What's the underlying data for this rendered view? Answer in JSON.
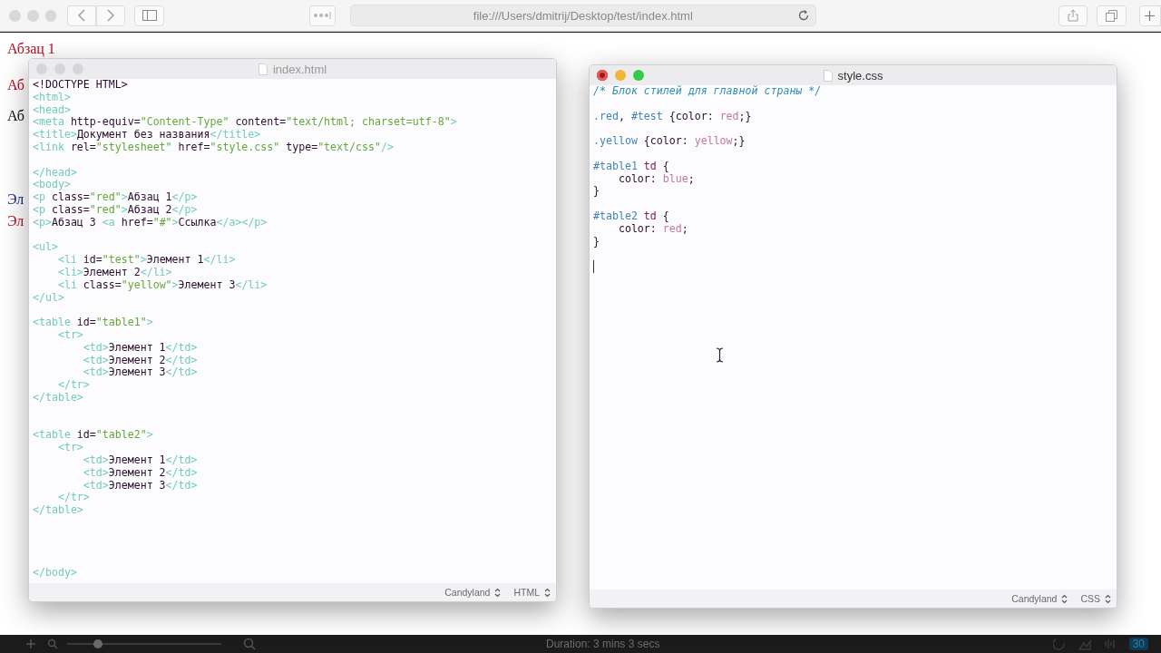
{
  "browser": {
    "url": "file:///Users/dmitrij/Desktop/test/index.html"
  },
  "page_text": [
    {
      "text": "Абзац 1",
      "color": "#b3122e",
      "kind": "paragraph"
    },
    {
      "text": "Аб",
      "color": "#b3122e",
      "kind": "paragraph"
    },
    {
      "text": "Аб",
      "color": "#111111",
      "kind": "paragraph"
    },
    {
      "text": "Эл",
      "color": "#1c2a8c",
      "kind": "cell"
    },
    {
      "text": "Эл",
      "color": "#b3122e",
      "kind": "cell"
    }
  ],
  "editors": [
    {
      "title": "index.html",
      "active": false,
      "footer": [
        "Candyland",
        "HTML"
      ],
      "lines": [
        {
          "kind": "code",
          "tokens": [
            {
              "t": "<!DOCTYPE HTML>",
              "kind": "text"
            }
          ]
        },
        {
          "kind": "code",
          "tokens": [
            {
              "t": "<html>",
              "kind": "tag"
            }
          ]
        },
        {
          "kind": "code",
          "tokens": [
            {
              "t": "<head>",
              "kind": "tag"
            }
          ]
        },
        {
          "kind": "code",
          "tokens": [
            {
              "t": "<meta",
              "kind": "tag"
            },
            {
              "t": " http-equiv=",
              "kind": "attr"
            },
            {
              "t": "\"Content-Type\"",
              "kind": "str"
            },
            {
              "t": " content=",
              "kind": "attr"
            },
            {
              "t": "\"text/html; charset=utf-8\"",
              "kind": "str"
            },
            {
              "t": ">",
              "kind": "tag"
            }
          ]
        },
        {
          "kind": "code",
          "tokens": [
            {
              "t": "<title>",
              "kind": "tag"
            },
            {
              "t": "Документ без названия",
              "kind": "text"
            },
            {
              "t": "</title>",
              "kind": "tag"
            }
          ]
        },
        {
          "kind": "code",
          "tokens": [
            {
              "t": "<link",
              "kind": "tag"
            },
            {
              "t": " rel=",
              "kind": "attr"
            },
            {
              "t": "\"stylesheet\"",
              "kind": "str"
            },
            {
              "t": " href=",
              "kind": "attr"
            },
            {
              "t": "\"style.css\"",
              "kind": "str"
            },
            {
              "t": " type=",
              "kind": "attr"
            },
            {
              "t": "\"text/css\"",
              "kind": "str"
            },
            {
              "t": "/>",
              "kind": "tag"
            }
          ]
        },
        {
          "kind": "blank"
        },
        {
          "kind": "code",
          "tokens": [
            {
              "t": "</head>",
              "kind": "tag"
            }
          ]
        },
        {
          "kind": "code",
          "tokens": [
            {
              "t": "<body>",
              "kind": "tag"
            }
          ]
        },
        {
          "kind": "code",
          "tokens": [
            {
              "t": "<p",
              "kind": "tag"
            },
            {
              "t": " class=",
              "kind": "attr"
            },
            {
              "t": "\"red\"",
              "kind": "str"
            },
            {
              "t": ">",
              "kind": "tag"
            },
            {
              "t": "Абзац 1",
              "kind": "text"
            },
            {
              "t": "</p>",
              "kind": "tag"
            }
          ]
        },
        {
          "kind": "code",
          "tokens": [
            {
              "t": "<p",
              "kind": "tag"
            },
            {
              "t": " class=",
              "kind": "attr"
            },
            {
              "t": "\"red\"",
              "kind": "str"
            },
            {
              "t": ">",
              "kind": "tag"
            },
            {
              "t": "Абзац 2",
              "kind": "text"
            },
            {
              "t": "</p>",
              "kind": "tag"
            }
          ]
        },
        {
          "kind": "code",
          "tokens": [
            {
              "t": "<p>",
              "kind": "tag"
            },
            {
              "t": "Абзац 3 ",
              "kind": "text"
            },
            {
              "t": "<a",
              "kind": "tag"
            },
            {
              "t": " href=",
              "kind": "attr"
            },
            {
              "t": "\"#\"",
              "kind": "str"
            },
            {
              "t": ">",
              "kind": "tag"
            },
            {
              "t": "Ссылка",
              "kind": "text"
            },
            {
              "t": "</a></p>",
              "kind": "tag"
            }
          ]
        },
        {
          "kind": "blank"
        },
        {
          "kind": "code",
          "tokens": [
            {
              "t": "<ul>",
              "kind": "tag"
            }
          ]
        },
        {
          "kind": "code",
          "tokens": [
            {
              "t": "    <li",
              "kind": "tag"
            },
            {
              "t": " id=",
              "kind": "attr"
            },
            {
              "t": "\"test\"",
              "kind": "str"
            },
            {
              "t": ">",
              "kind": "tag"
            },
            {
              "t": "Элемент 1",
              "kind": "text"
            },
            {
              "t": "</li>",
              "kind": "tag"
            }
          ]
        },
        {
          "kind": "code",
          "tokens": [
            {
              "t": "    <li>",
              "kind": "tag"
            },
            {
              "t": "Элемент 2",
              "kind": "text"
            },
            {
              "t": "</li>",
              "kind": "tag"
            }
          ]
        },
        {
          "kind": "code",
          "tokens": [
            {
              "t": "    <li",
              "kind": "tag"
            },
            {
              "t": " class=",
              "kind": "attr"
            },
            {
              "t": "\"yellow\"",
              "kind": "str"
            },
            {
              "t": ">",
              "kind": "tag"
            },
            {
              "t": "Элемент 3",
              "kind": "text"
            },
            {
              "t": "</li>",
              "kind": "tag"
            }
          ]
        },
        {
          "kind": "code",
          "tokens": [
            {
              "t": "</ul>",
              "kind": "tag"
            }
          ]
        },
        {
          "kind": "blank"
        },
        {
          "kind": "code",
          "tokens": [
            {
              "t": "<table",
              "kind": "tag"
            },
            {
              "t": " id=",
              "kind": "attr"
            },
            {
              "t": "\"table1\"",
              "kind": "str"
            },
            {
              "t": ">",
              "kind": "tag"
            }
          ]
        },
        {
          "kind": "code",
          "tokens": [
            {
              "t": "    <tr>",
              "kind": "tag"
            }
          ]
        },
        {
          "kind": "code",
          "tokens": [
            {
              "t": "        <td>",
              "kind": "tag"
            },
            {
              "t": "Элемент 1",
              "kind": "text"
            },
            {
              "t": "</td>",
              "kind": "tag"
            }
          ]
        },
        {
          "kind": "code",
          "tokens": [
            {
              "t": "        <td>",
              "kind": "tag"
            },
            {
              "t": "Элемент 2",
              "kind": "text"
            },
            {
              "t": "</td>",
              "kind": "tag"
            }
          ]
        },
        {
          "kind": "code",
          "tokens": [
            {
              "t": "        <td>",
              "kind": "tag"
            },
            {
              "t": "Элемент 3",
              "kind": "text"
            },
            {
              "t": "</td>",
              "kind": "tag"
            }
          ]
        },
        {
          "kind": "code",
          "tokens": [
            {
              "t": "    </tr>",
              "kind": "tag"
            }
          ]
        },
        {
          "kind": "code",
          "tokens": [
            {
              "t": "</table>",
              "kind": "tag"
            }
          ]
        },
        {
          "kind": "blank"
        },
        {
          "kind": "blank"
        },
        {
          "kind": "code",
          "tokens": [
            {
              "t": "<table",
              "kind": "tag"
            },
            {
              "t": " id=",
              "kind": "attr"
            },
            {
              "t": "\"table2\"",
              "kind": "str"
            },
            {
              "t": ">",
              "kind": "tag"
            }
          ]
        },
        {
          "kind": "code",
          "tokens": [
            {
              "t": "    <tr>",
              "kind": "tag"
            }
          ]
        },
        {
          "kind": "code",
          "tokens": [
            {
              "t": "        <td>",
              "kind": "tag"
            },
            {
              "t": "Элемент 1",
              "kind": "text"
            },
            {
              "t": "</td>",
              "kind": "tag"
            }
          ]
        },
        {
          "kind": "code",
          "tokens": [
            {
              "t": "        <td>",
              "kind": "tag"
            },
            {
              "t": "Элемент 2",
              "kind": "text"
            },
            {
              "t": "</td>",
              "kind": "tag"
            }
          ]
        },
        {
          "kind": "code",
          "tokens": [
            {
              "t": "        <td>",
              "kind": "tag"
            },
            {
              "t": "Элемент 3",
              "kind": "text"
            },
            {
              "t": "</td>",
              "kind": "tag"
            }
          ]
        },
        {
          "kind": "code",
          "tokens": [
            {
              "t": "    </tr>",
              "kind": "tag"
            }
          ]
        },
        {
          "kind": "code",
          "tokens": [
            {
              "t": "</table>",
              "kind": "tag"
            }
          ]
        },
        {
          "kind": "blank"
        },
        {
          "kind": "blank"
        },
        {
          "kind": "blank"
        },
        {
          "kind": "blank"
        },
        {
          "kind": "code",
          "tokens": [
            {
              "t": "</body>",
              "kind": "tag"
            }
          ]
        }
      ]
    },
    {
      "title": "style.css",
      "active": true,
      "footer": [
        "Candyland",
        "CSS"
      ],
      "lines": [
        {
          "kind": "code",
          "tokens": [
            {
              "t": "/* Блок стилей для главной страны */",
              "kind": "comment"
            }
          ]
        },
        {
          "kind": "blank"
        },
        {
          "kind": "code",
          "tokens": [
            {
              "t": ".red",
              "kind": "sel"
            },
            {
              "t": ", ",
              "kind": "punct"
            },
            {
              "t": "#test",
              "kind": "sel"
            },
            {
              "t": " {color: ",
              "kind": "punct"
            },
            {
              "t": "red",
              "kind": "val"
            },
            {
              "t": ";}",
              "kind": "punct"
            }
          ]
        },
        {
          "kind": "blank"
        },
        {
          "kind": "code",
          "tokens": [
            {
              "t": ".yellow",
              "kind": "sel"
            },
            {
              "t": " {color: ",
              "kind": "punct"
            },
            {
              "t": "yellow",
              "kind": "val"
            },
            {
              "t": ";}",
              "kind": "punct"
            }
          ]
        },
        {
          "kind": "blank"
        },
        {
          "kind": "code",
          "tokens": [
            {
              "t": "#table1",
              "kind": "sel"
            },
            {
              "t": " td",
              "kind": "elem"
            },
            {
              "t": " {",
              "kind": "punct"
            }
          ]
        },
        {
          "kind": "code",
          "tokens": [
            {
              "t": "    color: ",
              "kind": "punct"
            },
            {
              "t": "blue",
              "kind": "val"
            },
            {
              "t": ";",
              "kind": "punct"
            }
          ]
        },
        {
          "kind": "code",
          "tokens": [
            {
              "t": "}",
              "kind": "punct"
            }
          ]
        },
        {
          "kind": "blank"
        },
        {
          "kind": "code",
          "tokens": [
            {
              "t": "#table2",
              "kind": "sel"
            },
            {
              "t": " td",
              "kind": "elem"
            },
            {
              "t": " {",
              "kind": "punct"
            }
          ]
        },
        {
          "kind": "code",
          "tokens": [
            {
              "t": "    color: ",
              "kind": "punct"
            },
            {
              "t": "red",
              "kind": "val"
            },
            {
              "t": ";",
              "kind": "punct"
            }
          ]
        },
        {
          "kind": "code",
          "tokens": [
            {
              "t": "}",
              "kind": "punct"
            }
          ]
        },
        {
          "kind": "blank"
        },
        {
          "kind": "caret"
        }
      ]
    }
  ],
  "player": {
    "duration": "Duration: 3 mins 3 secs",
    "zoom_slider": {
      "level": 0.2
    },
    "badge": "30"
  }
}
